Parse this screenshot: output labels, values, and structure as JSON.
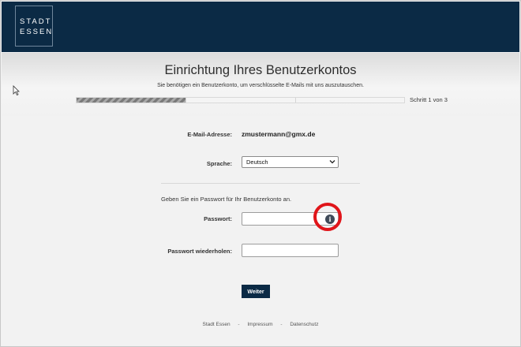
{
  "header": {
    "logo_line1": "STADT",
    "logo_line2": "ESSEN"
  },
  "page": {
    "title": "Einrichtung Ihres Benutzerkontos",
    "subtitle": "Sie benötigen ein Benutzerkonto, um verschlüsselte E-Mails mit uns auszutauschen.",
    "step_text": "Schritt 1 von 3",
    "progress": {
      "current_step": 1,
      "total_steps": 3
    }
  },
  "form": {
    "email_label": "E-Mail-Adresse:",
    "email_value": "zmustermann@gmx.de",
    "language_label": "Sprache:",
    "language_value": "Deutsch",
    "password_hint": "Geben Sie ein Passwort für Ihr Benutzerkonto an.",
    "password_label": "Passwort:",
    "password_repeat_label": "Passwort wiederholen:",
    "info_icon_glyph": "i",
    "submit_label": "Weiter"
  },
  "footer": {
    "links": [
      "Stadt Essen",
      "Impressum",
      "Datenschutz"
    ],
    "separator": "-"
  },
  "colors": {
    "header_bg": "#0b2a45",
    "highlight_ring": "#e0151a",
    "button_bg": "#0b2a45"
  }
}
